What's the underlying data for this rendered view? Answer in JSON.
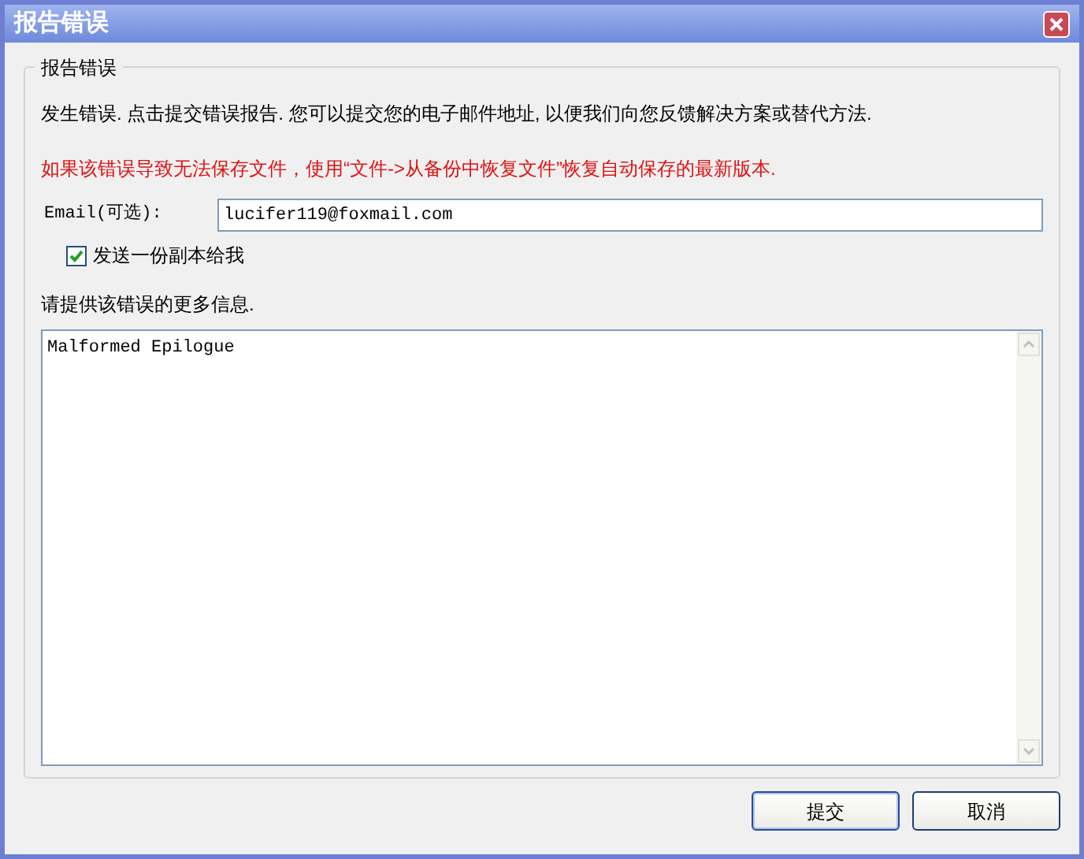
{
  "window": {
    "title": "报告错误"
  },
  "group": {
    "title": "报告错误"
  },
  "intro": "发生错误. 点击提交错误报告. 您可以提交您的电子邮件地址, 以便我们向您反馈解决方案或替代方法.",
  "warning": "如果该错误导致无法保存文件，使用“文件->从备份中恢复文件”恢复自动保存的最新版本.",
  "email": {
    "label": "Email(可选):",
    "value": "lucifer119@foxmail.com"
  },
  "copy_checkbox": {
    "label": "发送一份副本给我",
    "checked": true
  },
  "details": {
    "label": "请提供该错误的更多信息.",
    "value": "Malformed Epilogue"
  },
  "buttons": [
    {
      "label": "提交",
      "kind": "default"
    },
    {
      "label": "取消",
      "kind": "normal"
    }
  ]
}
